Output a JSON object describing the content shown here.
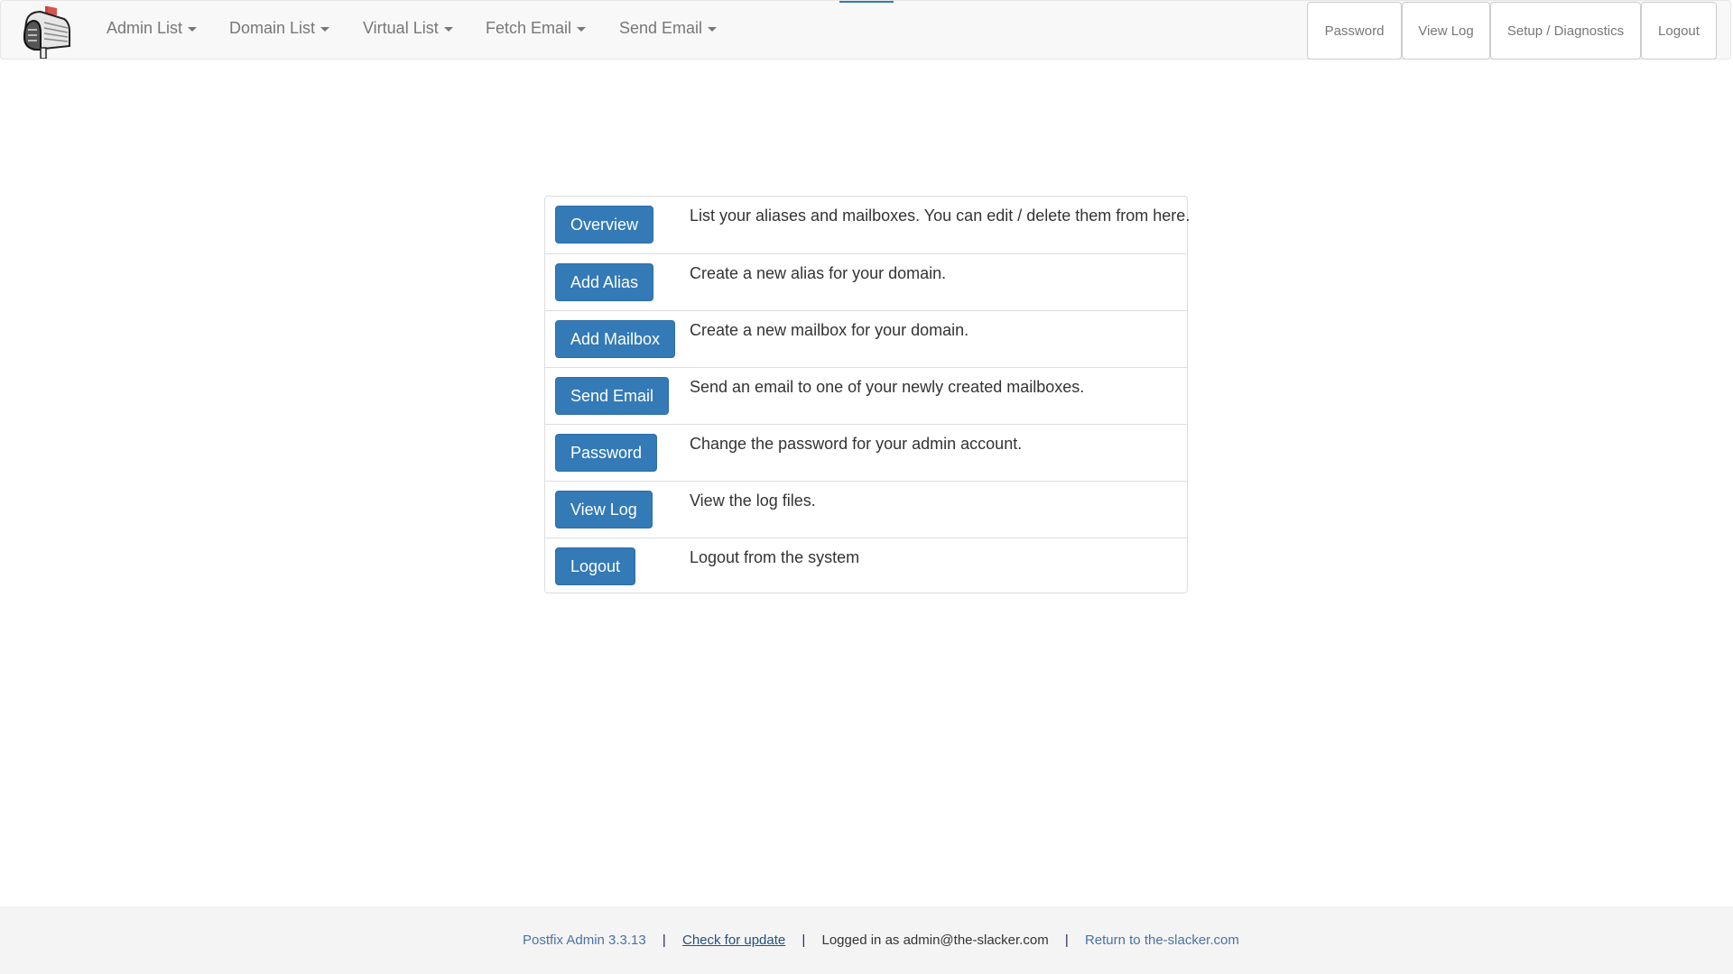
{
  "navbar": {
    "logo_icon": "mailbox-icon",
    "left_menu": [
      {
        "label": "Admin List",
        "icon": "caret-down-icon"
      },
      {
        "label": "Domain List",
        "icon": "caret-down-icon"
      },
      {
        "label": "Virtual List",
        "icon": "caret-down-icon"
      },
      {
        "label": "Fetch Email",
        "icon": "caret-down-icon"
      },
      {
        "label": "Send Email",
        "icon": "caret-down-icon"
      }
    ],
    "right_menu": [
      {
        "label": "Password"
      },
      {
        "label": "View Log"
      },
      {
        "label": "Setup / Diagnostics"
      },
      {
        "label": "Logout"
      }
    ]
  },
  "main": {
    "rows": [
      {
        "button": "Overview",
        "description": "List your aliases and mailboxes. You can edit / delete them from here."
      },
      {
        "button": "Add Alias",
        "description": "Create a new alias for your domain."
      },
      {
        "button": "Add Mailbox",
        "description": "Create a new mailbox for your domain."
      },
      {
        "button": "Send Email",
        "description": "Send an email to one of your newly created mailboxes."
      },
      {
        "button": "Password",
        "description": "Change the password for your admin account."
      },
      {
        "button": "View Log",
        "description": "View the log files."
      },
      {
        "button": "Logout",
        "description": "Logout from the system"
      }
    ]
  },
  "footer": {
    "version": "Postfix Admin 3.3.13",
    "check_update": "Check for update",
    "logged_in": "Logged in as admin@the-slacker.com",
    "return_link": "Return to the-slacker.com",
    "separator": "|"
  },
  "colors": {
    "primary": "#337ab7",
    "navbar_bg": "#f8f8f8",
    "footer_bg": "#f4f4f4"
  }
}
